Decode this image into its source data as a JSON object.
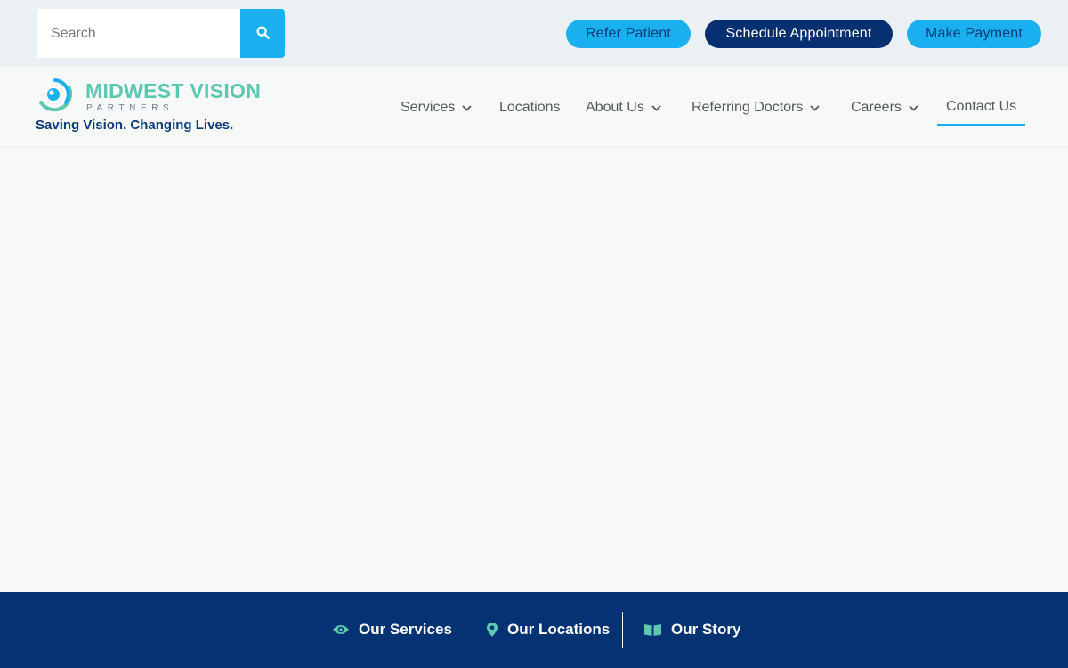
{
  "search": {
    "placeholder": "Search",
    "icon": "search-icon"
  },
  "top_actions": {
    "refer": "Refer Patient",
    "schedule": "Schedule Appointment",
    "payment": "Make Payment"
  },
  "brand": {
    "name": "MIDWEST VISION",
    "sub": "PARTNERS",
    "tagline": "Saving Vision. Changing Lives."
  },
  "nav": {
    "services": "Services",
    "locations": "Locations",
    "about": "About Us",
    "referring": "Referring Doctors",
    "careers": "Careers",
    "contact": "Contact Us"
  },
  "footer": {
    "services": "Our Services",
    "locations": "Our Locations",
    "story": "Our Story"
  },
  "colors": {
    "accent": "#1ab0f0",
    "navy": "#073070",
    "teal": "#5bc8b0",
    "footer": "#043272"
  }
}
